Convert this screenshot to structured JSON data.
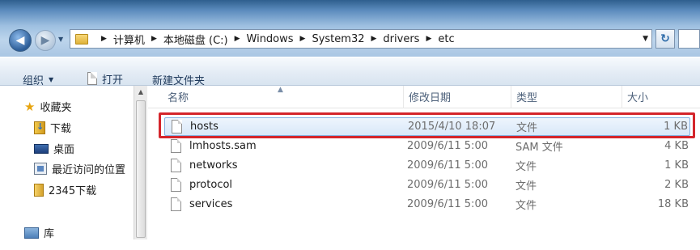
{
  "address_bar": {
    "crumbs": [
      "计算机",
      "本地磁盘 (C:)",
      "Windows",
      "System32",
      "drivers",
      "etc"
    ]
  },
  "toolbar": {
    "organize_label": "组织",
    "open_label": "打开",
    "new_folder_label": "新建文件夹"
  },
  "navpane": {
    "items": [
      {
        "label": "收藏夹",
        "icon": "star-icon"
      },
      {
        "label": "下载",
        "icon": "downloads-folder-icon"
      },
      {
        "label": "桌面",
        "icon": "desktop-icon"
      },
      {
        "label": "最近访问的位置",
        "icon": "recent-places-icon"
      },
      {
        "label": "2345下载",
        "icon": "folder-icon"
      },
      {
        "label": "库",
        "icon": "library-icon"
      }
    ]
  },
  "filelist": {
    "columns": [
      "名称",
      "修改日期",
      "类型",
      "大小"
    ],
    "rows": [
      {
        "name": "hosts",
        "date": "2015/4/10 18:07",
        "type": "文件",
        "size": "1 KB",
        "selected": true
      },
      {
        "name": "lmhosts.sam",
        "date": "2009/6/11 5:00",
        "type": "SAM 文件",
        "size": "4 KB"
      },
      {
        "name": "networks",
        "date": "2009/6/11 5:00",
        "type": "文件",
        "size": "1 KB"
      },
      {
        "name": "protocol",
        "date": "2009/6/11 5:00",
        "type": "文件",
        "size": "2 KB"
      },
      {
        "name": "services",
        "date": "2009/6/11 5:00",
        "type": "文件",
        "size": "18 KB"
      }
    ]
  },
  "colors": {
    "highlight": "#d4252b",
    "selection": "#d9e8f9"
  }
}
